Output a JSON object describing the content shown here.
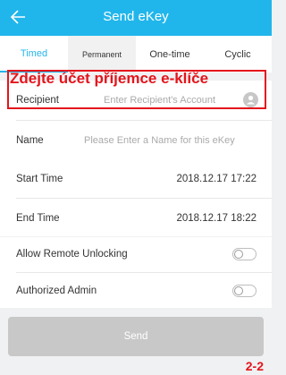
{
  "header": {
    "title": "Send eKey",
    "back_icon": "arrow-left-icon"
  },
  "tabs": [
    {
      "label": "Timed",
      "active": true
    },
    {
      "label": "Permanent",
      "active": false
    },
    {
      "label": "One-time",
      "active": false
    },
    {
      "label": "Cyclic",
      "active": false
    }
  ],
  "form": {
    "recipient_label": "Recipient",
    "recipient_placeholder": "Enter Recipient's Account",
    "recipient_icon": "person-icon",
    "name_label": "Name",
    "name_placeholder": "Please Enter a Name for this eKey",
    "start_label": "Start Time",
    "start_value": "2018.12.17 17:22",
    "end_label": "End Time",
    "end_value": "2018.12.17 18:22",
    "remote_label": "Allow Remote Unlocking",
    "admin_label": "Authorized Admin",
    "send_label": "Send"
  },
  "annotation": {
    "text": "Zdejte účet příjemce  e-klíče",
    "page_number": "2-2",
    "color": "#e4141b"
  },
  "colors": {
    "accent": "#21b6eb",
    "send_disabled": "#c8c8c8"
  }
}
